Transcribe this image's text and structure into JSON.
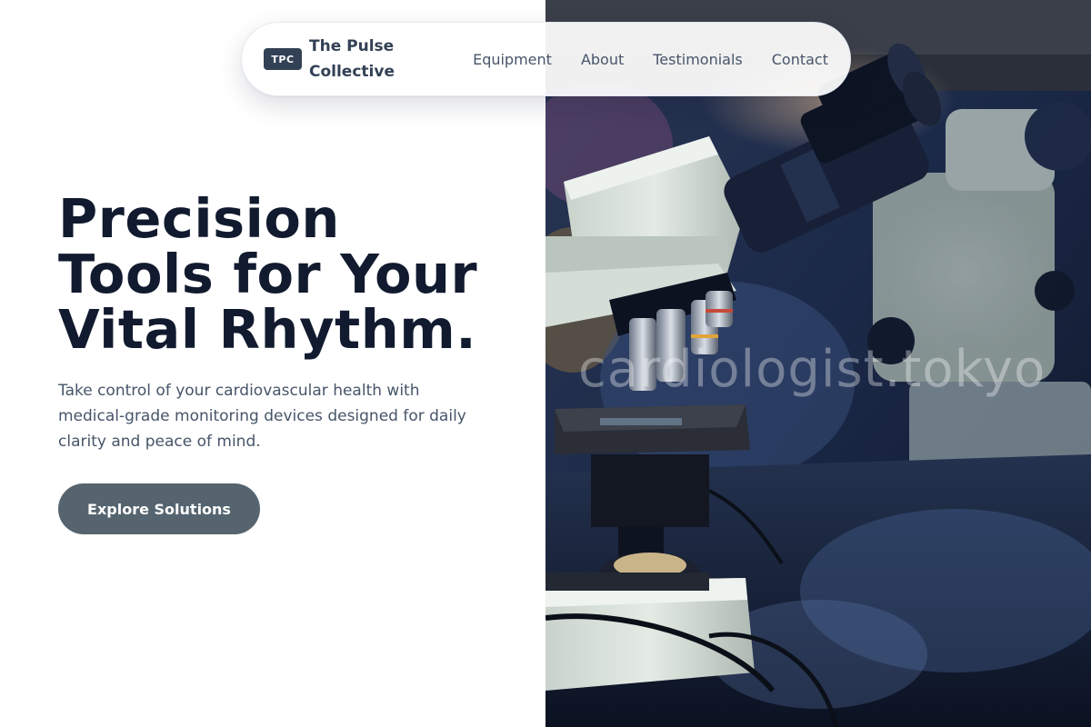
{
  "brand": {
    "badge": "TPC",
    "line1": "The Pulse",
    "line2": "Collective"
  },
  "nav": {
    "items": [
      {
        "label": "Equipment"
      },
      {
        "label": "About"
      },
      {
        "label": "Testimonials"
      },
      {
        "label": "Contact"
      }
    ]
  },
  "hero": {
    "headline_lines": [
      "Precision",
      "Tools for Your",
      "Vital Rhythm."
    ],
    "subtext": "Take control of your cardiovascular health with medical-grade monitoring devices designed for daily clarity and peace of mind.",
    "cta_label": "Explore Solutions",
    "image_icon": "microscope-photo",
    "watermark": "cardiologist.tokyo"
  },
  "colors": {
    "headline": "#111a2e",
    "body_text": "#475569",
    "cta_bg": "#55646f",
    "badge_bg": "#334155"
  }
}
